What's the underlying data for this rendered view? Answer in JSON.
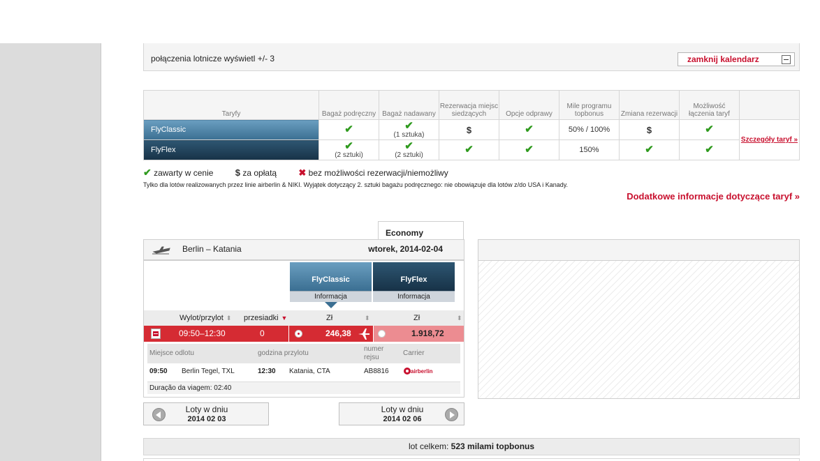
{
  "calendar_bar": {
    "text": "połączenia lotnicze wyświetl +/- 3",
    "close_label": "zamknij kalendarz"
  },
  "fares_table": {
    "headers": [
      "Taryfy",
      "Bagaż podręczny",
      "Bagaż nadawany",
      "Rezerwacja miejsc siedzących",
      "Opcje odprawy",
      "Mile programu topbonus",
      "Zmiana rezerwacji",
      "Możliwość łączenia taryf"
    ],
    "rows": [
      {
        "name": "FlyClassic",
        "hand_bag": "",
        "checked_bag": "(1 sztuka)",
        "seat": "$",
        "checkin": "",
        "miles": "50% / 100%",
        "change": "$",
        "combine": ""
      },
      {
        "name": "FlyFlex",
        "hand_bag": "(2 sztuki)",
        "checked_bag": "(2 sztuki)",
        "seat": "",
        "checkin": "",
        "miles": "150%",
        "change": "",
        "combine": ""
      }
    ],
    "details_link": "Szczegóły taryf »"
  },
  "legend": {
    "included": "zawarty w cenie",
    "paid": "za opłatą",
    "not_available": "bez możliwości rezerwacji/niemożliwy"
  },
  "note": "Tylko dla lotów realizowanych przez linie airberlin & NIKI. Wyjątek dotyczący 2. sztuki bagażu podręcznego: nie obowiązuje dla lotów z/do USA i Kanady.",
  "more_info": "Dodatkowe informacje dotyczące taryf »",
  "flight": {
    "cabin_tab": "Economy",
    "route": "Berlin – Katania",
    "date": "wtorek, 2014-02-04",
    "fare_columns": [
      {
        "name": "FlyClassic",
        "info": "Informacja"
      },
      {
        "name": "FlyFlex",
        "info": "Informacja"
      }
    ],
    "sort_headers": {
      "time": "Wylot/przylot",
      "stops": "przesiadki",
      "price1": "Zł",
      "price2": "Zł"
    },
    "row": {
      "time": "09:50–12:30",
      "stops": "0",
      "price_classic": "246,38",
      "price_flex": "1.918,72"
    },
    "detail_headers": {
      "from": "Miejsce odlotu",
      "arrival": "godzina przylotu",
      "flight_no": "numer rejsu",
      "carrier": "Carrier"
    },
    "detail": {
      "dep_time": "09:50",
      "from": "Berlin Tegel, TXL",
      "arr_time": "12:30",
      "to": "Katania, CTA",
      "flight_no": "AB8816",
      "carrier": "airberlin"
    },
    "duration": "Duração da viagem: 02:40"
  },
  "nav": {
    "prev_label": "Loty w dniu",
    "prev_date": "2014 02 03",
    "next_label": "Loty w dniu",
    "next_date": "2014 02 06"
  },
  "total": {
    "prefix": "lot celkem:",
    "value": "523 milami topbonus"
  },
  "colors": {
    "brand_red": "#c8102e",
    "check_green": "#2f9a1e",
    "fare_classic": "#3b6f92",
    "fare_flex": "#173247"
  }
}
